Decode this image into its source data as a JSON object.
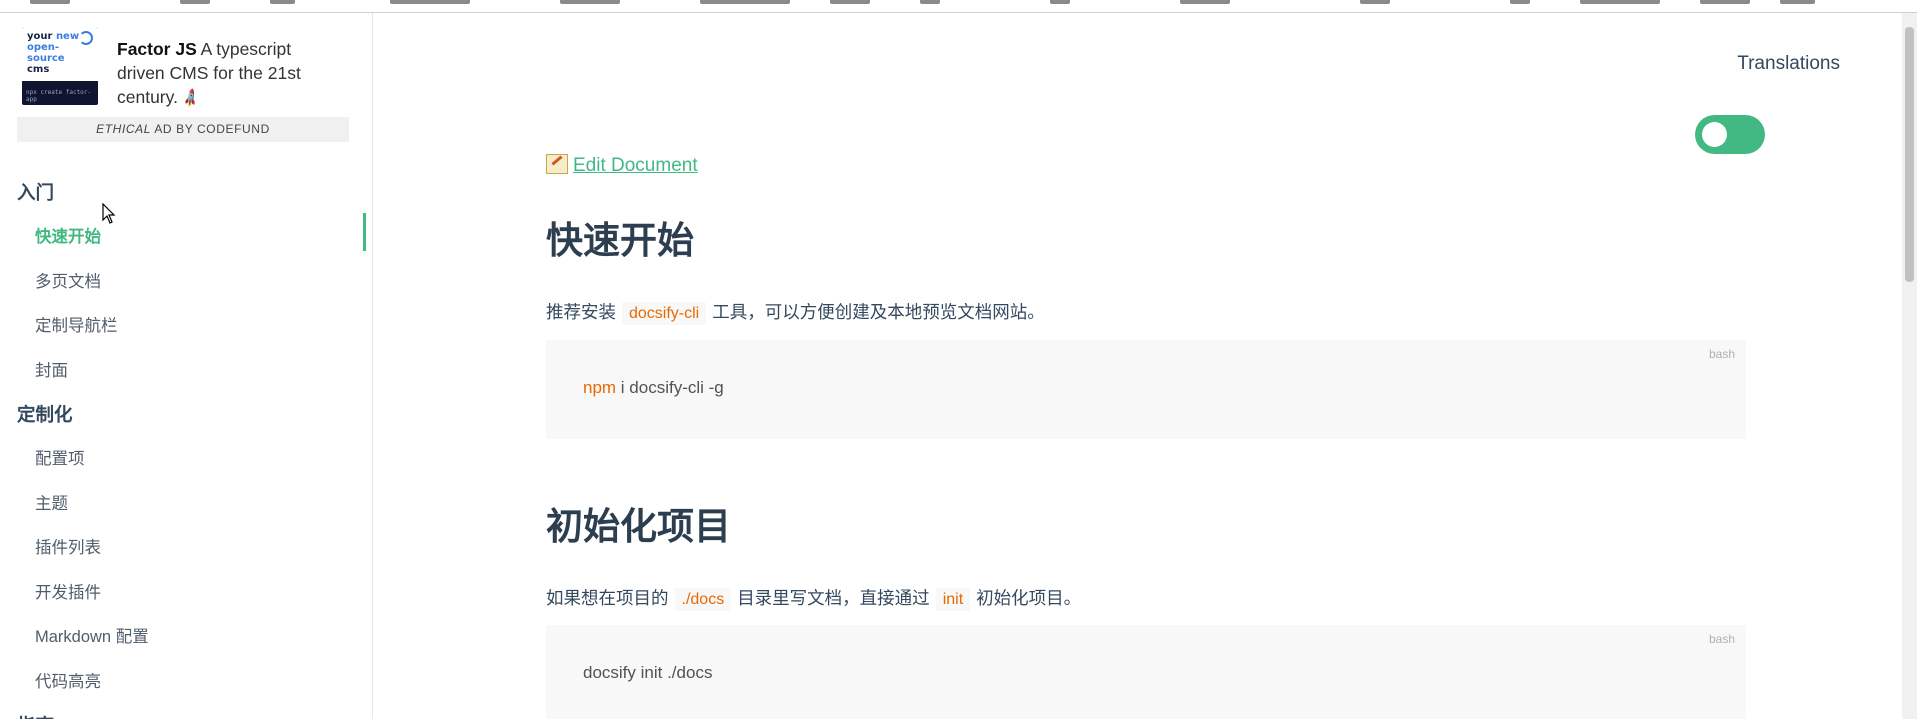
{
  "ad": {
    "image_line1": "your",
    "image_line1_accent": "new",
    "image_line2": "open-source",
    "image_line3": "cms",
    "image_cmd": "npx create factor-app",
    "title": "Factor JS",
    "description": "A typescript driven CMS for the 21st century.",
    "rocket_glyph": "🚀",
    "credit_italic": "ETHICAL",
    "credit_rest": "AD BY CODEFUND"
  },
  "sidebar": {
    "sections": [
      {
        "title": "入门",
        "items": [
          "快速开始",
          "多页文档",
          "定制导航栏",
          "封面"
        ]
      },
      {
        "title": "定制化",
        "items": [
          "配置项",
          "主题",
          "插件列表",
          "开发插件",
          "Markdown 配置",
          "代码高亮"
        ]
      },
      {
        "title": "指南",
        "items": []
      }
    ],
    "active_item": "快速开始"
  },
  "header": {
    "translations": "Translations"
  },
  "toggle": {
    "state": "on",
    "color": "#42b983"
  },
  "content": {
    "edit_link": "Edit Document",
    "sections": [
      {
        "heading": "快速开始",
        "para_before": "推荐安装",
        "para_code": "docsify-cli",
        "para_after": "工具，可以方便创建及本地预览文档网站。",
        "code_lang": "bash",
        "code_keyword": "npm",
        "code_rest": " i docsify-cli -g"
      },
      {
        "heading": "初始化项目",
        "para_before": "如果想在项目的",
        "para_code": "./docs",
        "para_middle": "目录里写文档，直接通过",
        "para_code2": "init",
        "para_after": "初始化项目。",
        "code_lang": "bash",
        "code_rest": "docsify init ./docs"
      }
    ]
  },
  "colors": {
    "accent": "#42b983",
    "inline_code": "#e96900",
    "heading": "#2c3e50"
  }
}
